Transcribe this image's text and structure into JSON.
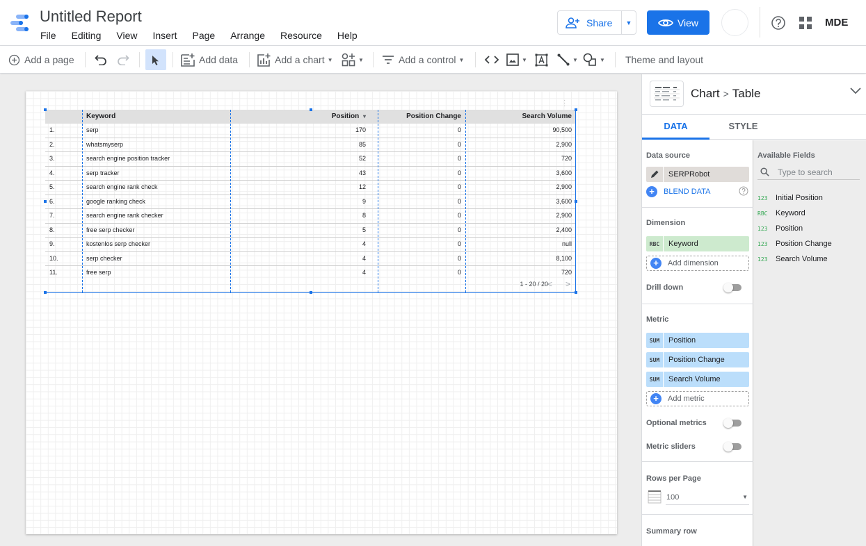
{
  "app": {
    "title": "Untitled Report",
    "menu": [
      "File",
      "Editing",
      "View",
      "Insert",
      "Page",
      "Arrange",
      "Resource",
      "Help"
    ],
    "share_label": "Share",
    "view_label": "View",
    "user_initials": "MDE",
    "brand_color": "#1a73e8"
  },
  "toolbar": {
    "add_page": "Add a page",
    "add_data": "Add data",
    "add_chart": "Add a chart",
    "add_control": "Add a control",
    "theme_layout": "Theme and layout",
    "icons": [
      "add-circle-icon",
      "undo-icon",
      "redo-icon",
      "select-pointer-icon",
      "add-data-icon",
      "add-chart-icon",
      "community-viz-icon",
      "filter-control-icon",
      "embed-code-icon",
      "image-icon",
      "text-box-icon",
      "line-icon",
      "shape-icon"
    ]
  },
  "table": {
    "headers": [
      "",
      "Keyword",
      "Position",
      "Position Change",
      "Search Volume"
    ],
    "sort_indicator": "▾",
    "rows": [
      {
        "idx": "1.",
        "keyword": "serp",
        "position": "170",
        "change": "0",
        "volume": "90,500"
      },
      {
        "idx": "2.",
        "keyword": "whatsmyserp",
        "position": "85",
        "change": "0",
        "volume": "2,900"
      },
      {
        "idx": "3.",
        "keyword": "search engine position tracker",
        "position": "52",
        "change": "0",
        "volume": "720"
      },
      {
        "idx": "4.",
        "keyword": "serp tracker",
        "position": "43",
        "change": "0",
        "volume": "3,600"
      },
      {
        "idx": "5.",
        "keyword": "search engine rank check",
        "position": "12",
        "change": "0",
        "volume": "2,900"
      },
      {
        "idx": "6.",
        "keyword": "google ranking check",
        "position": "9",
        "change": "0",
        "volume": "3,600"
      },
      {
        "idx": "7.",
        "keyword": "search engine rank checker",
        "position": "8",
        "change": "0",
        "volume": "2,900"
      },
      {
        "idx": "8.",
        "keyword": "free serp checker",
        "position": "5",
        "change": "0",
        "volume": "2,400"
      },
      {
        "idx": "9.",
        "keyword": "kostenlos serp checker",
        "position": "4",
        "change": "0",
        "volume": "null"
      },
      {
        "idx": "10.",
        "keyword": "serp checker",
        "position": "4",
        "change": "0",
        "volume": "8,100"
      },
      {
        "idx": "11.",
        "keyword": "free serp",
        "position": "4",
        "change": "0",
        "volume": "720"
      }
    ],
    "pagination": "1 - 20 / 20"
  },
  "panel": {
    "breadcrumb_root": "Chart",
    "breadcrumb_sep": ">",
    "breadcrumb_leaf": "Table",
    "tabs": [
      "DATA",
      "STYLE"
    ],
    "active_tab": "DATA",
    "data_source_title": "Data source",
    "data_source": "SERPRobot",
    "blend_data": "BLEND DATA",
    "dimension_title": "Dimension",
    "dimension": {
      "type": "RBC",
      "name": "Keyword"
    },
    "add_dimension": "Add dimension",
    "drill_down": "Drill down",
    "drill_down_on": false,
    "metric_title": "Metric",
    "metrics": [
      {
        "agg": "SUM",
        "name": "Position"
      },
      {
        "agg": "SUM",
        "name": "Position Change"
      },
      {
        "agg": "SUM",
        "name": "Search Volume"
      }
    ],
    "add_metric": "Add metric",
    "optional_metrics": "Optional metrics",
    "optional_metrics_on": false,
    "metric_sliders": "Metric sliders",
    "metric_sliders_on": false,
    "rows_per_page_title": "Rows per Page",
    "rows_per_page": "100",
    "summary_row": "Summary row",
    "available_fields_title": "Available Fields",
    "search_placeholder": "Type to search",
    "fields": [
      {
        "type": "123",
        "name": "Initial Position"
      },
      {
        "type": "RBC",
        "name": "Keyword"
      },
      {
        "type": "123",
        "name": "Position"
      },
      {
        "type": "123",
        "name": "Position Change"
      },
      {
        "type": "123",
        "name": "Search Volume"
      }
    ]
  }
}
